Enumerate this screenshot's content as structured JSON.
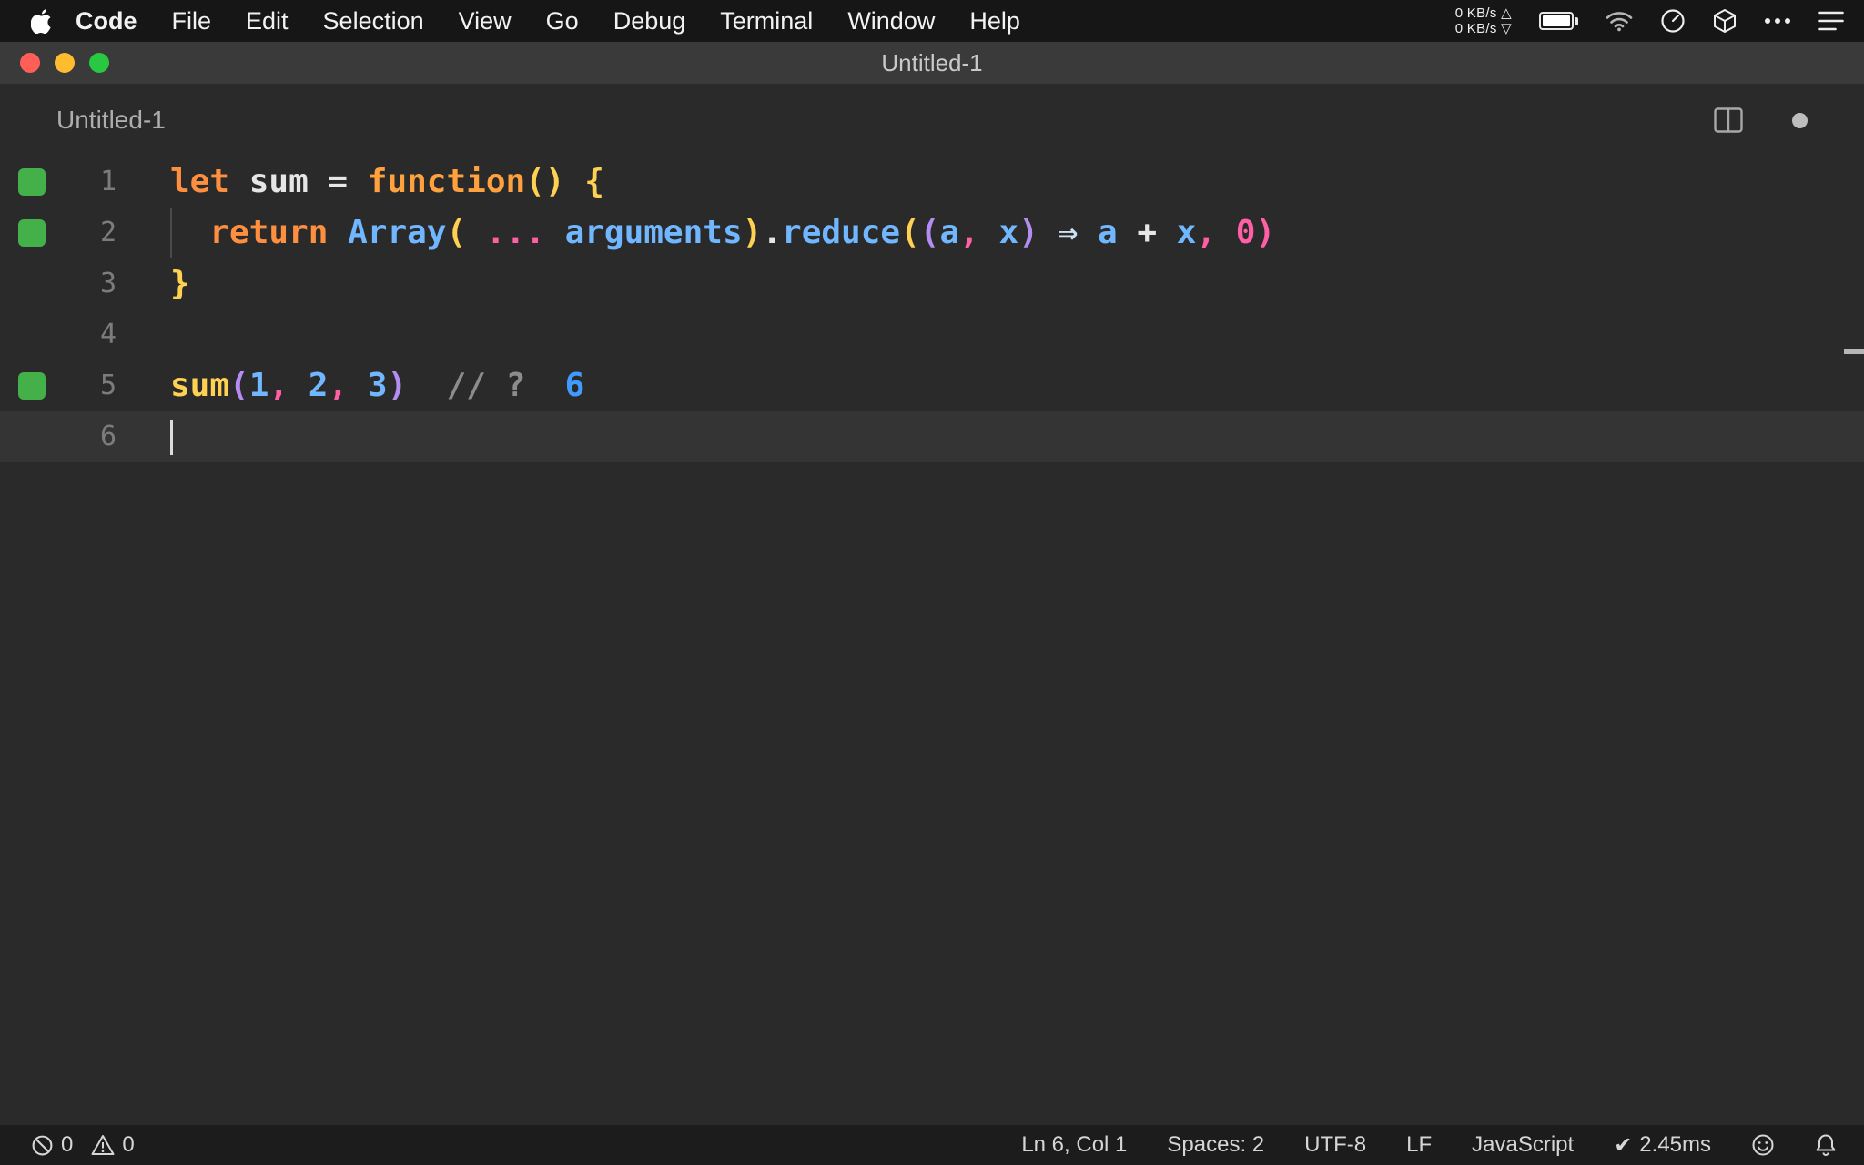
{
  "menu_bar": {
    "app_name": "Code",
    "items": [
      "File",
      "Edit",
      "Selection",
      "View",
      "Go",
      "Debug",
      "Terminal",
      "Window",
      "Help"
    ],
    "net_up": "0 KB/s",
    "net_down": "0 KB/s",
    "up_symbol": "△",
    "down_symbol": "▽"
  },
  "window": {
    "title": "Untitled-1"
  },
  "tab_bar": {
    "filename": "Untitled-1"
  },
  "editor": {
    "lines": [
      {
        "num": "1",
        "marked": true,
        "tokens": [
          {
            "t": "let",
            "c": "orange"
          },
          {
            "t": " ",
            "c": "plain"
          },
          {
            "t": "sum",
            "c": "plain"
          },
          {
            "t": " = ",
            "c": "plain"
          },
          {
            "t": "function",
            "c": "orange2"
          },
          {
            "t": "()",
            "c": "yellow"
          },
          {
            "t": " ",
            "c": "plain"
          },
          {
            "t": "{",
            "c": "yellow"
          }
        ]
      },
      {
        "num": "2",
        "marked": true,
        "indent_guide": true,
        "tokens": [
          {
            "t": "  ",
            "c": "plain"
          },
          {
            "t": "return",
            "c": "orange"
          },
          {
            "t": " ",
            "c": "plain"
          },
          {
            "t": "Array",
            "c": "blue"
          },
          {
            "t": "(",
            "c": "yellow"
          },
          {
            "t": " ",
            "c": "plain"
          },
          {
            "t": "...",
            "c": "pink"
          },
          {
            "t": " ",
            "c": "plain"
          },
          {
            "t": "arguments",
            "c": "blue"
          },
          {
            "t": ")",
            "c": "yellow"
          },
          {
            "t": ".",
            "c": "plain"
          },
          {
            "t": "reduce",
            "c": "blue"
          },
          {
            "t": "(",
            "c": "yellow"
          },
          {
            "t": "(",
            "c": "purple"
          },
          {
            "t": "a",
            "c": "blue"
          },
          {
            "t": ",",
            "c": "pink"
          },
          {
            "t": " ",
            "c": "plain"
          },
          {
            "t": "x",
            "c": "blue"
          },
          {
            "t": ")",
            "c": "purple"
          },
          {
            "t": " ",
            "c": "plain"
          },
          {
            "t": "⇒",
            "c": "arrow"
          },
          {
            "t": " ",
            "c": "plain"
          },
          {
            "t": "a",
            "c": "blue"
          },
          {
            "t": " ",
            "c": "plain"
          },
          {
            "t": "+",
            "c": "plain"
          },
          {
            "t": " ",
            "c": "plain"
          },
          {
            "t": "x",
            "c": "blue"
          },
          {
            "t": ",",
            "c": "pink"
          },
          {
            "t": " ",
            "c": "plain"
          },
          {
            "t": "0",
            "c": "pink"
          },
          {
            "t": ")",
            "c": "pink"
          }
        ]
      },
      {
        "num": "3",
        "marked": false,
        "tokens": [
          {
            "t": "}",
            "c": "yellow"
          }
        ]
      },
      {
        "num": "4",
        "marked": false,
        "tokens": []
      },
      {
        "num": "5",
        "marked": true,
        "tokens": [
          {
            "t": "sum",
            "c": "yellow"
          },
          {
            "t": "(",
            "c": "purple"
          },
          {
            "t": "1",
            "c": "blue"
          },
          {
            "t": ",",
            "c": "pink"
          },
          {
            "t": " ",
            "c": "plain"
          },
          {
            "t": "2",
            "c": "blue"
          },
          {
            "t": ",",
            "c": "pink"
          },
          {
            "t": " ",
            "c": "plain"
          },
          {
            "t": "3",
            "c": "blue"
          },
          {
            "t": ")",
            "c": "purple"
          },
          {
            "t": "  ",
            "c": "plain"
          },
          {
            "t": "// ?",
            "c": "comment"
          },
          {
            "t": "  ",
            "c": "plain"
          },
          {
            "t": "6",
            "c": "result"
          }
        ]
      },
      {
        "num": "6",
        "marked": false,
        "active": true,
        "cursor": true,
        "tokens": []
      }
    ]
  },
  "status_bar": {
    "errors": "0",
    "warnings": "0",
    "cursor_position": "Ln 6, Col 1",
    "indentation": "Spaces: 2",
    "encoding": "UTF-8",
    "eol": "LF",
    "language": "JavaScript",
    "check_symbol": "✔",
    "perf": "2.45ms"
  },
  "colors": {
    "orange": "#ff8f40",
    "orange2": "#ffa23e",
    "yellow": "#ffd152",
    "blue": "#71b7ff",
    "pink": "#ff5fa5",
    "purple": "#b48cf2",
    "plain": "#e6e6e6",
    "comment": "#8c8c8c",
    "result": "#3f9bff",
    "arrow": "#cfe0f0",
    "gutter_mark": "#43b04a"
  }
}
